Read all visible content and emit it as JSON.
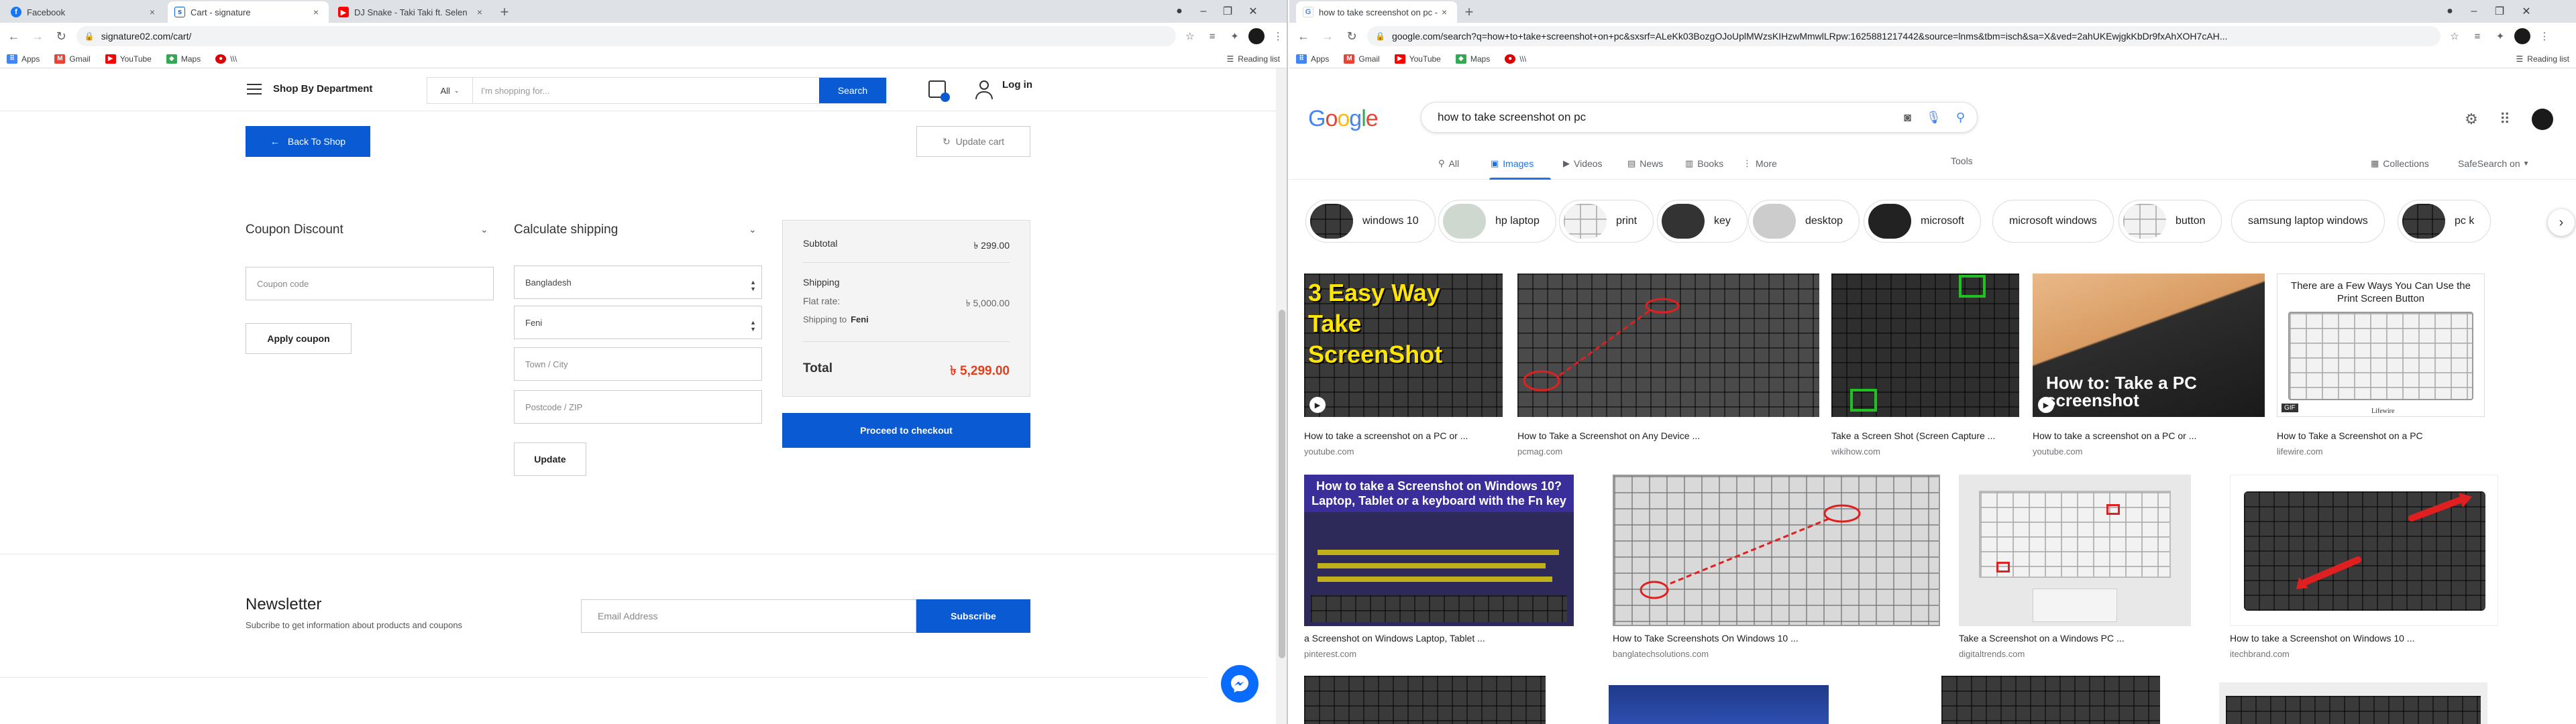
{
  "left_browser": {
    "tabs": [
      {
        "title": "Facebook",
        "favicon": "facebook-icon",
        "color": "#1877f2"
      },
      {
        "title": "Cart - signature",
        "favicon": "site-icon",
        "color": "#0a5bd3"
      },
      {
        "title": "DJ Snake - Taki Taki ft. Selen",
        "favicon": "youtube-icon",
        "color": "#ff0000"
      }
    ],
    "url": "signature02.com/cart/",
    "bookmarks": [
      "Apps",
      "Gmail",
      "YouTube",
      "Maps",
      "\\\\\\"
    ],
    "reading_list": "Reading list"
  },
  "shop": {
    "dept_label": "Shop By Department",
    "search_category": "All",
    "search_placeholder": "I'm shopping for...",
    "search_button": "Search",
    "login_label": "Log in",
    "back_button": "Back To Shop",
    "update_cart_button": "Update cart",
    "coupon": {
      "title": "Coupon Discount",
      "placeholder": "Coupon code",
      "apply_button": "Apply coupon"
    },
    "shipping": {
      "title": "Calculate shipping",
      "country": "Bangladesh",
      "state": "Feni",
      "city_placeholder": "Town / City",
      "zip_placeholder": "Postcode / ZIP",
      "update_button": "Update"
    },
    "summary": {
      "subtotal_label": "Subtotal",
      "subtotal_value": "৳ 299.00",
      "shipping_label": "Shipping",
      "flat_rate_label": "Flat rate:",
      "flat_rate_value": "৳ 5,000.00",
      "shipping_to": "Shipping to",
      "shipping_to_place": "Feni",
      "total_label": "Total",
      "total_value": "৳ 5,299.00",
      "checkout_button": "Proceed to checkout"
    },
    "newsletter": {
      "title": "Newsletter",
      "subtitle": "Subcribe to get information about products and coupons",
      "email_placeholder": "Email Address",
      "subscribe_button": "Subscribe"
    },
    "colors": {
      "primary": "#0a5bd3",
      "total": "#e2401c"
    }
  },
  "right_browser": {
    "tab_title": "how to take screenshot on pc - G",
    "url": "google.com/search?q=how+to+take+screenshot+on+pc&sxsrf=ALeKk03BozgOJoUplMWzsKIHzwMmwlLRpw:1625881217442&source=lnms&tbm=isch&sa=X&ved=2ahUKEwjgkKbDr9fxAhXOH7cAH...",
    "bookmarks": [
      "Apps",
      "Gmail",
      "YouTube",
      "Maps",
      "\\\\\\"
    ],
    "reading_list": "Reading list"
  },
  "google": {
    "logo": "Google",
    "query": "how to take screenshot on pc",
    "tabs": [
      "All",
      "Images",
      "Videos",
      "News",
      "Books",
      "More"
    ],
    "tools": "Tools",
    "collections": "Collections",
    "safesearch": "SafeSearch on",
    "chips": [
      "windows 10",
      "hp laptop",
      "print",
      "key",
      "desktop",
      "microsoft",
      "microsoft windows",
      "button",
      "samsung laptop windows",
      "pc k"
    ],
    "results": [
      {
        "caption": "How to take a screenshot on a PC or ...",
        "source": "youtube.com",
        "overlay": "3 Easy Way Take ScreenShot"
      },
      {
        "caption": "How to Take a Screenshot on Any Device ...",
        "source": "pcmag.com",
        "overlay": ""
      },
      {
        "caption": "Take a Screen Shot (Screen Capture ...",
        "source": "wikihow.com",
        "overlay": ""
      },
      {
        "caption": "How to take a screenshot on a PC or ...",
        "source": "youtube.com",
        "overlay": "How to: Take a PC screenshot"
      },
      {
        "caption": "How to Take a Screenshot on a PC",
        "source": "lifewire.com",
        "overlay": "There are a Few Ways You Can Use the Print Screen Button"
      },
      {
        "caption": "a Screenshot on Windows Laptop, Tablet ...",
        "source": "pinterest.com",
        "overlay": "How to take a Screenshot on Windows 10? Laptop, Tablet or a keyboard with the Fn key"
      },
      {
        "caption": "How to Take Screenshots On Windows 10 ...",
        "source": "banglatechsolutions.com",
        "overlay": ""
      },
      {
        "caption": "Take a Screenshot on a Windows PC ...",
        "source": "digitaltrends.com",
        "overlay": ""
      },
      {
        "caption": "How to take a Screenshot on Windows 10 ...",
        "source": "itechbrand.com",
        "overlay": ""
      }
    ],
    "badges": {
      "gif": "GIF",
      "lifewire": "Lifewire"
    }
  }
}
